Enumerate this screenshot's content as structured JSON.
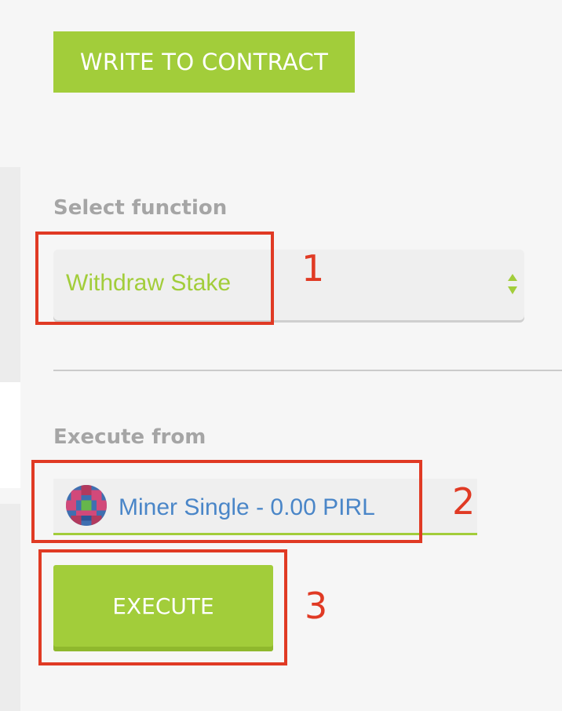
{
  "header": {
    "title_button": "WRITE TO CONTRACT"
  },
  "function_select": {
    "label": "Select function",
    "selected_value": "Withdraw Stake"
  },
  "execute_from": {
    "label": "Execute from",
    "account": "Miner Single - 0.00 PIRL"
  },
  "execute_button": {
    "label": "EXECUTE"
  },
  "annotations": [
    "1",
    "2",
    "3"
  ],
  "colors": {
    "accent_green": "#a2cd3a",
    "annotation_red": "#e03a24",
    "account_blue": "#4a86c8",
    "label_gray": "#a5a5a5"
  },
  "icons": [
    "select-arrows-icon",
    "identicon-avatar"
  ]
}
